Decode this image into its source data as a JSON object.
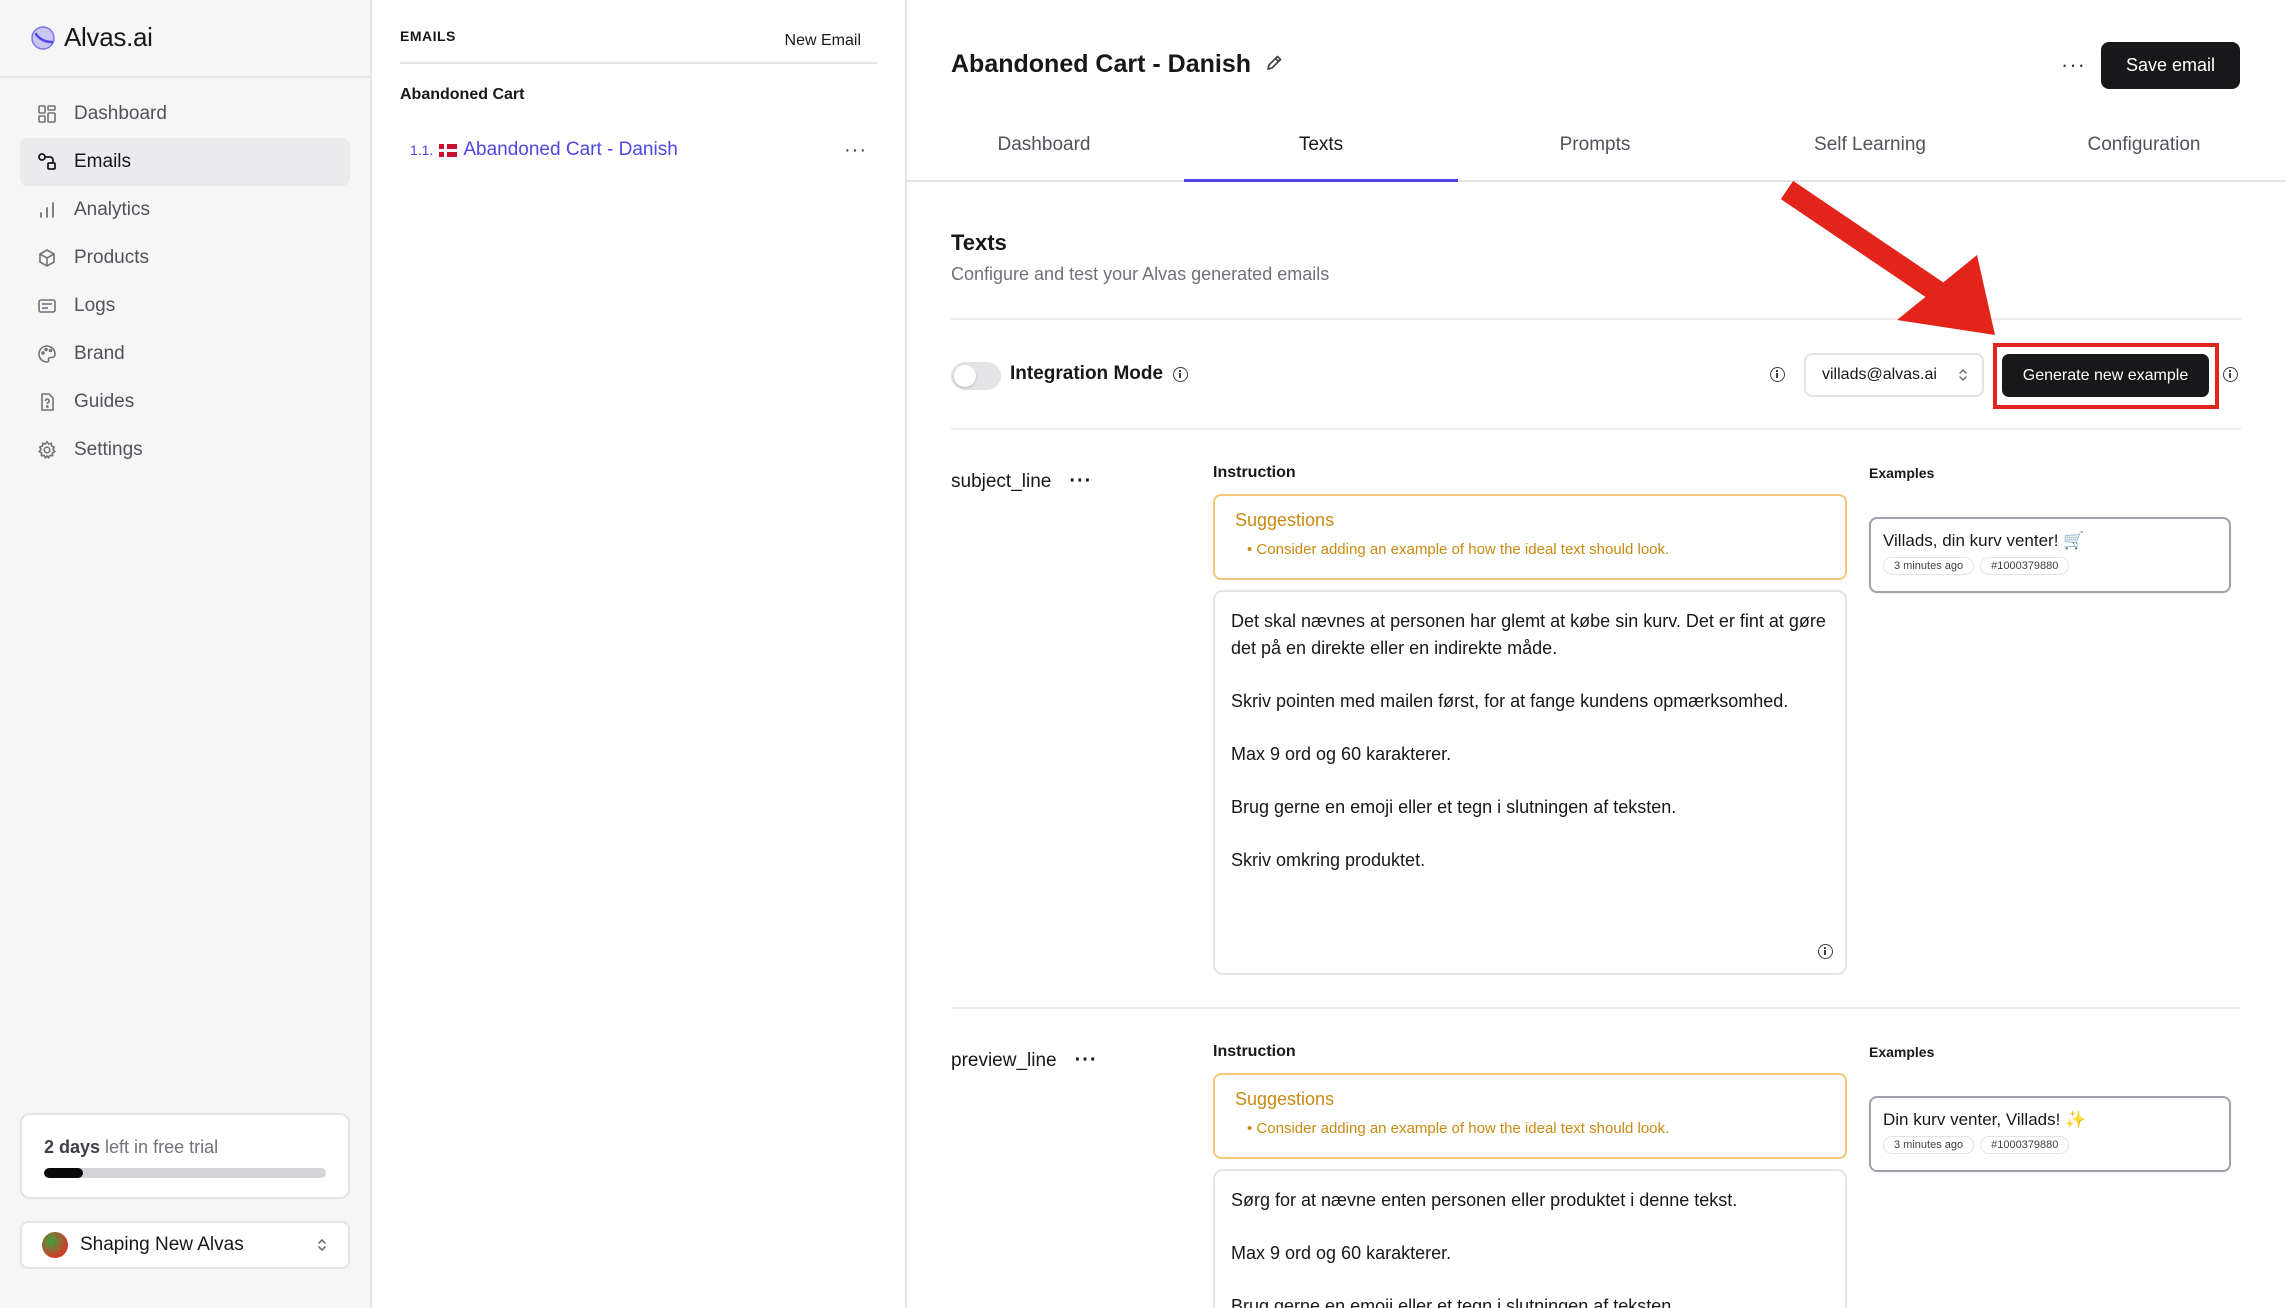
{
  "app": {
    "logo_text": "Alvas.ai"
  },
  "sidebar": {
    "items": [
      {
        "label": "Dashboard",
        "icon": "dashboard-icon"
      },
      {
        "label": "Emails",
        "icon": "emails-icon",
        "active": true
      },
      {
        "label": "Analytics",
        "icon": "analytics-icon"
      },
      {
        "label": "Products",
        "icon": "products-icon"
      },
      {
        "label": "Logs",
        "icon": "logs-icon"
      },
      {
        "label": "Brand",
        "icon": "palette-icon"
      },
      {
        "label": "Guides",
        "icon": "guides-icon"
      },
      {
        "label": "Settings",
        "icon": "gear-icon"
      }
    ],
    "trial": {
      "days": "2 days",
      "rest": " left in free trial",
      "progress": 0.14
    },
    "workspace": {
      "name": "Shaping New Alvas"
    }
  },
  "emails_panel": {
    "title": "EMAILS",
    "new_email": "New Email",
    "group": "Abandoned Cart",
    "items": [
      {
        "number": "1.1.",
        "name": "Abandoned Cart - Danish"
      }
    ]
  },
  "main": {
    "title": "Abandoned Cart - Danish",
    "save_label": "Save email",
    "more": "···",
    "tabs": [
      "Dashboard",
      "Texts",
      "Prompts",
      "Self Learning",
      "Configuration"
    ],
    "active_tab": "Texts",
    "section": {
      "title": "Texts",
      "subtitle": "Configure and test your Alvas generated emails"
    },
    "integration_mode": {
      "label": "Integration Mode",
      "enabled": false
    },
    "user_select": {
      "value": "villads@alvas.ai"
    },
    "generate_label": "Generate new example",
    "fields": [
      {
        "name": "subject_line",
        "instruction_label": "Instruction",
        "examples_label": "Examples",
        "suggestion_title": "Suggestions",
        "suggestion": "Consider adding an example of how the ideal text should look.",
        "instruction": [
          "Det skal nævnes at personen har glemt at købe sin kurv. Det er fint at gøre det på en direkte eller en indirekte måde.",
          "Skriv pointen med mailen først, for at fange kundens opmærksomhed.",
          "Max 9 ord og 60 karakterer.",
          "Brug gerne en emoji eller et tegn i slutningen af teksten.",
          "Skriv omkring produktet."
        ],
        "example": {
          "text": "Villads, din kurv venter! 🛒",
          "time": "3 minutes ago",
          "id": "#1000379880"
        }
      },
      {
        "name": "preview_line",
        "instruction_label": "Instruction",
        "examples_label": "Examples",
        "suggestion_title": "Suggestions",
        "suggestion": "Consider adding an example of how the ideal text should look.",
        "instruction": [
          "Sørg for at nævne enten personen eller produktet i denne tekst.",
          "Max 9 ord og 60 karakterer.",
          "Brug gerne en emoji eller et tegn i slutningen af teksten."
        ],
        "example": {
          "text": "Din kurv venter, Villads! ✨",
          "time": "3 minutes ago",
          "id": "#1000379880"
        }
      }
    ]
  },
  "colors": {
    "accent": "#4f46e5",
    "annotation": "#e3241b",
    "suggestion": "#c98a11"
  }
}
